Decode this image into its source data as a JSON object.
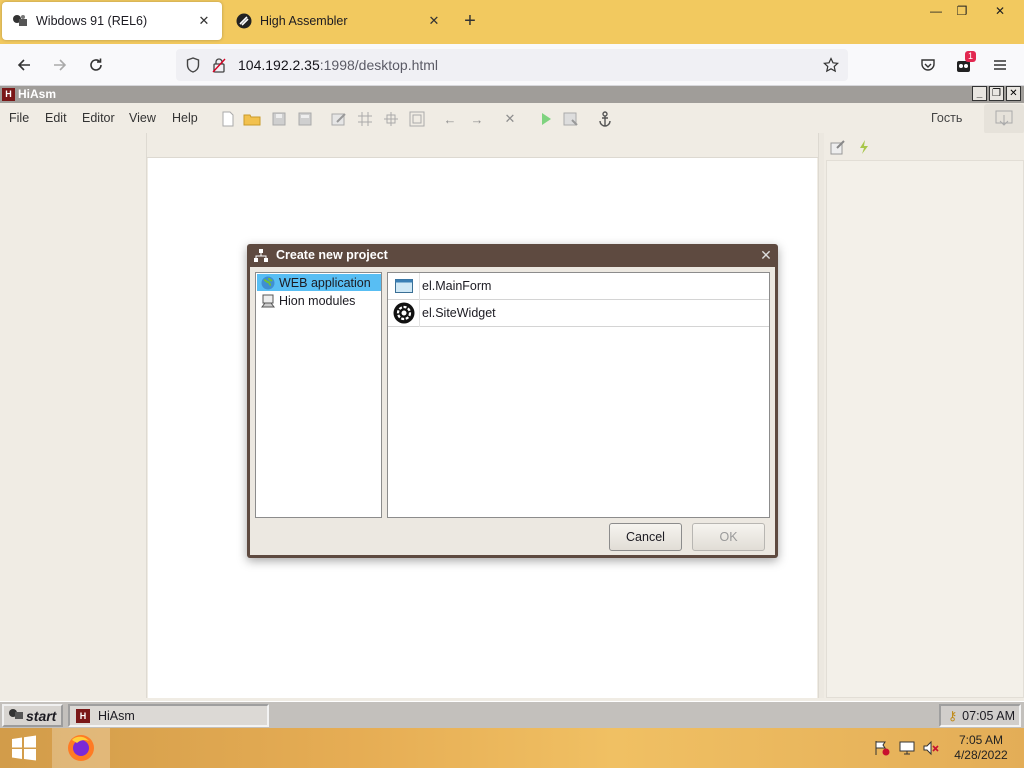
{
  "browser": {
    "tabs": [
      {
        "title": "Wibdows 91 (REL6)",
        "active": true,
        "icon": "wibdows-icon"
      },
      {
        "title": "High Assembler",
        "active": false,
        "icon": "hiasm-tab-icon"
      }
    ],
    "url_host": "104.192.2.35",
    "url_rest": ":1998/desktop.html",
    "notification_count": "1"
  },
  "app": {
    "title": "HiAsm",
    "menu": [
      "File",
      "Edit",
      "Editor",
      "View",
      "Help"
    ],
    "user_label": "Гость"
  },
  "dialog": {
    "title": "Create new project",
    "categories": [
      {
        "label": "WEB application",
        "selected": true,
        "icon": "globe-icon"
      },
      {
        "label": "Hion modules",
        "selected": false,
        "icon": "modules-icon"
      }
    ],
    "projects": [
      {
        "label": "el.MainForm",
        "icon": "form-icon"
      },
      {
        "label": "el.SiteWidget",
        "icon": "gear-icon"
      }
    ],
    "cancel_label": "Cancel",
    "ok_label": "OK"
  },
  "inner_taskbar": {
    "start_label": "start",
    "task_label": "HiAsm",
    "clock": "07:05 AM"
  },
  "system_tray": {
    "time": "7:05 AM",
    "date": "4/28/2022"
  },
  "colors": {
    "tab_strip": "#f2c95f",
    "dialog_frame": "#5e4a40",
    "selection": "#58bef3"
  }
}
